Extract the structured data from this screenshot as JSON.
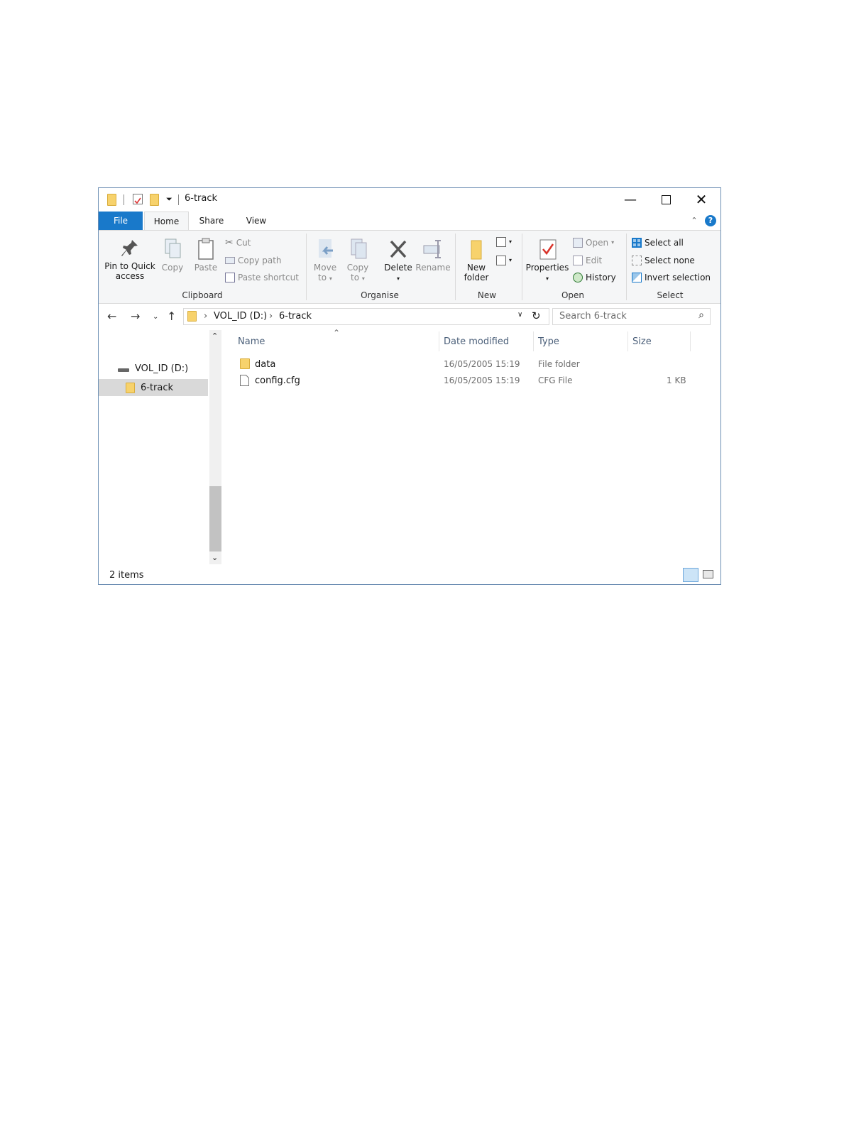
{
  "window": {
    "title": "6-track"
  },
  "tabs": [
    {
      "label": "File"
    },
    {
      "label": "Home"
    },
    {
      "label": "Share"
    },
    {
      "label": "View"
    }
  ],
  "ribbon": {
    "clipboard": {
      "pin": "Pin to Quick access",
      "pin_l1": "Pin to Quick",
      "pin_l2": "access",
      "copy": "Copy",
      "paste": "Paste",
      "cut": "Cut",
      "copy_path": "Copy path",
      "paste_shortcut": "Paste shortcut",
      "label": "Clipboard"
    },
    "organise": {
      "move_l1": "Move",
      "move_l2": "to",
      "copy_l1": "Copy",
      "copy_l2": "to",
      "delete": "Delete",
      "rename": "Rename",
      "label": "Organise"
    },
    "new": {
      "new_l1": "New",
      "new_l2": "folder",
      "label": "New"
    },
    "open": {
      "properties": "Properties",
      "open": "Open",
      "edit": "Edit",
      "history": "History",
      "label": "Open"
    },
    "select": {
      "select_all": "Select all",
      "select_none": "Select none",
      "invert": "Invert selection",
      "label": "Select"
    }
  },
  "address": {
    "crumbs": [
      "VOL_ID (D:)",
      "6-track"
    ],
    "search_placeholder": "Search 6-track"
  },
  "tree": [
    {
      "label": "VOL_ID (D:)"
    },
    {
      "label": "6-track"
    }
  ],
  "columns": [
    "Name",
    "Date modified",
    "Type",
    "Size"
  ],
  "files": [
    {
      "name": "data",
      "date": "16/05/2005 15:19",
      "type": "File folder",
      "size": "",
      "icon": "folder-icon"
    },
    {
      "name": "config.cfg",
      "date": "16/05/2005 15:19",
      "type": "CFG File",
      "size": "1 KB",
      "icon": "file-icon"
    }
  ],
  "status": {
    "count": "2 items"
  },
  "colors": {
    "accent": "#1979ca",
    "folder": "#f7d26c",
    "selected": "#d9d9d9"
  }
}
